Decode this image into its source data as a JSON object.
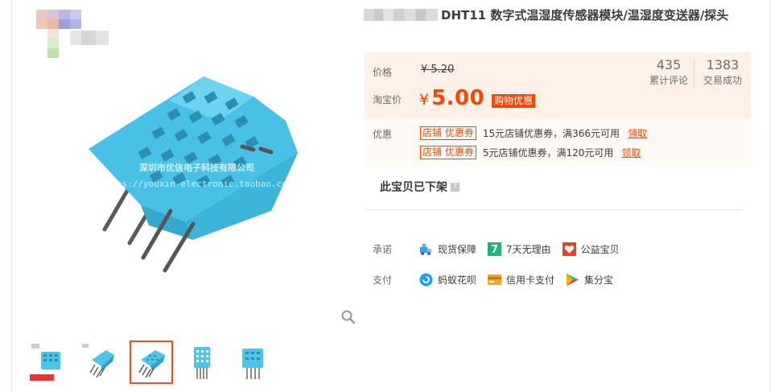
{
  "product": {
    "title": "DHT11 数字式温湿度传感器模块/温湿度变送器/探头",
    "watermark": {
      "line1": "深圳市优信电子科技有限公司",
      "line2": "https://youxin-electronic.taobao.com"
    }
  },
  "price": {
    "label": "价格",
    "original": "¥ 5.20",
    "taobao_label": "淘宝价",
    "currency": "¥",
    "value": "5.00",
    "promo_tag": "购物优惠"
  },
  "stats": [
    {
      "value": "435",
      "label": "累计评论"
    },
    {
      "value": "1383",
      "label": "交易成功"
    }
  ],
  "coupons": {
    "label": "优惠",
    "items": [
      {
        "tag": "店铺 优惠券",
        "text": "15元店铺优惠券，满366元可用",
        "claim": "领取"
      },
      {
        "tag": "店铺 优惠券",
        "text": "5元店铺优惠券，满120元可用",
        "claim": "领取"
      }
    ]
  },
  "status": {
    "off_shelf": "此宝贝已下架",
    "help_icon": "?"
  },
  "services": {
    "promise_label": "承诺",
    "promise": [
      {
        "icon": "delivery-icon",
        "label": "现货保障"
      },
      {
        "icon": "seven-day-icon",
        "label": "7天无理由",
        "badge": "7"
      },
      {
        "icon": "charity-icon",
        "label": "公益宝贝"
      }
    ],
    "pay_label": "支付",
    "pay": [
      {
        "icon": "huabei-icon",
        "label": "蚂蚁花呗"
      },
      {
        "icon": "credit-card-icon",
        "label": "信用卡支付"
      },
      {
        "icon": "jifenbao-icon",
        "label": "集分宝"
      }
    ]
  },
  "colors": {
    "accent": "#ff4400",
    "price_bg": "#fdf0e6",
    "sensor_blue": "#4ec4e8"
  }
}
